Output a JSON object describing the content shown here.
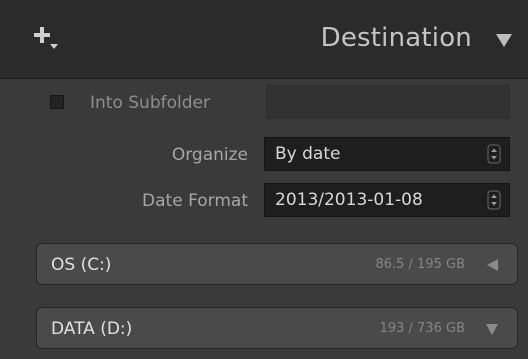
{
  "header": {
    "title": "Destination",
    "add_icon": "plus-with-dropdown-icon",
    "collapse_icon": "triangle-down-icon"
  },
  "subfolder": {
    "checked": false,
    "label": "Into Subfolder",
    "value": ""
  },
  "organize": {
    "label": "Organize",
    "value": "By date"
  },
  "date_format": {
    "label": "Date Format",
    "value": "2013/2013-01-08"
  },
  "volumes": [
    {
      "name": "OS (C:)",
      "usage": "86.5 / 195 GB",
      "state": "collapsed",
      "toggle_icon": "triangle-left-icon"
    },
    {
      "name": "DATA (D:)",
      "usage": "193 / 736 GB",
      "state": "expanded",
      "toggle_icon": "triangle-down-icon"
    }
  ],
  "colors": {
    "background": "#3a3a3a",
    "header_background": "#2b2b2b",
    "select_background": "#1e1e1e",
    "volume_background": "#4a4a4a"
  }
}
